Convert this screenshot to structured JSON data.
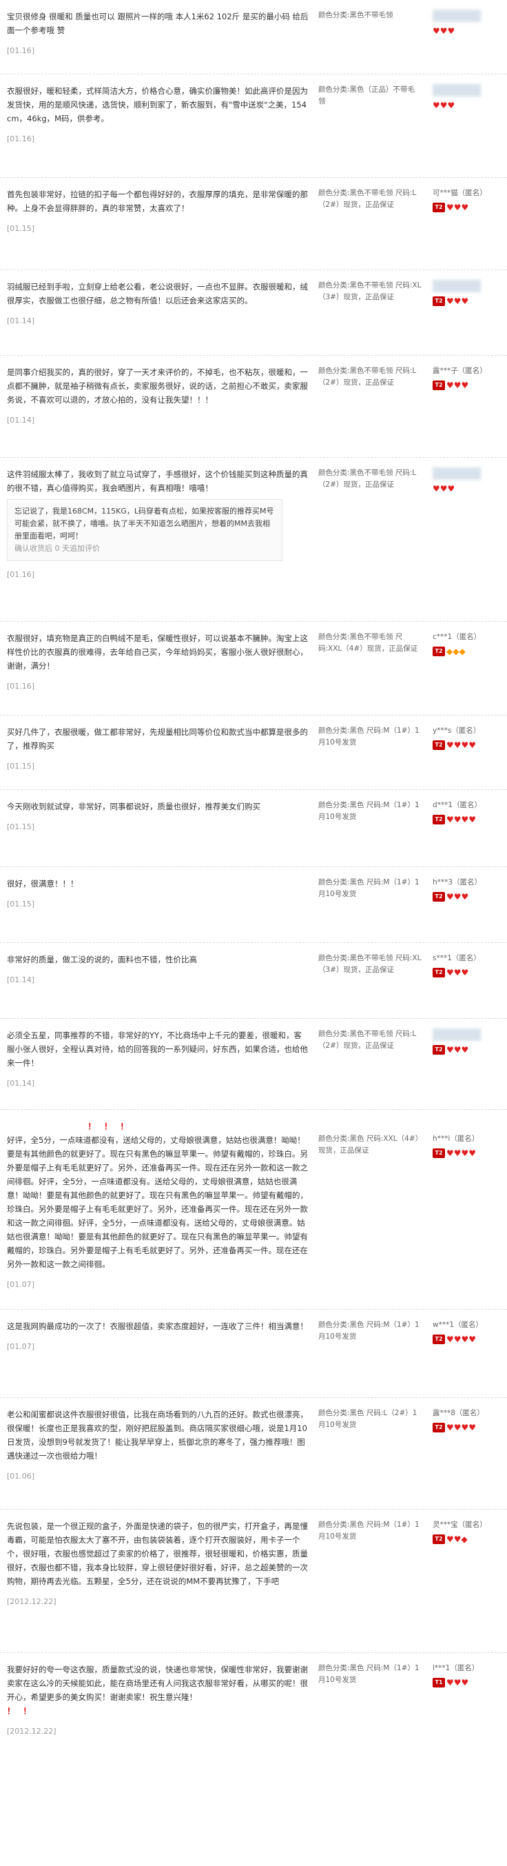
{
  "reviews": [
    {
      "content": "宝贝很修身 很暖和 质量也可以 跟照片一样的哦 本人1米62 102斤 是买的最小码 给后面一个参考哦 赞",
      "date": "[01.16]",
      "sku": "颜色分类:黑色不带毛领",
      "user": "",
      "badge": "♥♥♥"
    },
    {
      "content": "衣服很好，暖和轻柔，式样简洁大方，价格合心意，确实价廉物美！如此高评价是因为发货快，用的是顺风快递，选货快，顺利到家了，新衣服到，有\"雪中送炭\"之美，154cm，46kg，M码，供参考。",
      "date": "[01.16]",
      "sku": "颜色分类:黑色（正品）不带毛领",
      "user": "",
      "badge": "♥♥♥"
    },
    {
      "content": "首先包装非常好，拉链的扣子每一个都包得好好的，衣服厚厚的填充，是非常保暖的那种。上身不会显得胖胖的，真的非常赞，太喜欢了！",
      "date": "[01.15]",
      "sku": "颜色分类:黑色不带毛领 尺码:L（2#）现货，正品保证",
      "user": "可***猫（匿名）",
      "badge": "♥♥♥"
    },
    {
      "content": "羽绒服已经到手啦，立刻穿上给老公看，老公说很好，一点也不显胖。衣服很暖和，绒很厚实，衣服做工也很仔细，总之物有所值！以后还会来这家店买的。",
      "date": "[01.14]",
      "sku": "颜色分类:黑色不带毛领 尺码:XL（3#）现货，正品保证",
      "user": "",
      "badge": "♥♥♥"
    },
    {
      "content": "是同事介绍我买的，真的很好，穿了一天才来评价的，不掉毛，也不粘灰，很暖和，一点都不臃肿，就是袖子稍微有点长，卖家服务很好，说的话，之前担心不敢买，卖家服务说，不喜欢可以退的，才放心拍的，没有让我失望！！！",
      "date": "[01.14]",
      "sku": "颜色分类:黑色不带毛领 尺码:L（2#）现货，正品保证",
      "user": "露***子（匿名）",
      "badge": "♥♥♥"
    },
    {
      "content": "这件羽绒服太棒了，我收到了就立马试穿了，手感很好，这个价钱能买到这种质量的真的很不错，真心值得购买，我会晒图片，有真相哦！嘻嘻！",
      "date": "[01.16]",
      "sku": "颜色分类:黑色不带毛领 尺码:L（2#）现货，正品保证",
      "user": "",
      "badge": "♥♥♥",
      "append": "忘记说了，我是168CM，115KG，L码穿着有点松，如果按客服的推荐买M号可能会紧，就不换了，嘻嘻。执了半天不知道怎么晒图片，想着的MM去我相册里面看吧，呵呵！",
      "append_date": "确认收货后 0 天追加评价"
    },
    {
      "content": "衣服很好，填充物是真正的白鸭绒不是毛，保暖性很好，可以说基本不臃肿。淘宝上这样性价比的衣服真的很难得，去年给自己买，今年给妈妈买，客服小张人很好很耐心，谢谢，满分！",
      "date": "[01.16]",
      "sku": "颜色分类:黑色不带毛领 尺码:XXL（4#）现货，正品保证",
      "user": "c***1（匿名）",
      "badge": "◆◆◆"
    },
    {
      "content": "买好几件了，衣服很暖，做工都非常好，先规量相比同等价位和款式当中都算是很多的了，推荐购买",
      "date": "[01.15]",
      "sku": "颜色分类:黑色 尺码:M（1#）1月10号发货",
      "user": "y***s（匿名）",
      "badge": "♥♥♥♥"
    },
    {
      "content": "今天刚收到就试穿，非常好，同事都说好，质量也很好，推荐美女们购买",
      "date": "[01.15]",
      "sku": "颜色分类:黑色 尺码:M（1#）1月10号发货",
      "user": "d***1（匿名）",
      "badge": "♥♥♥♥"
    },
    {
      "content": "很好，很满意！！！",
      "date": "[01.15]",
      "sku": "颜色分类:黑色 尺码:M（1#）1月10号发货",
      "user": "h***3（匿名）",
      "badge": "♥♥♥"
    },
    {
      "content": "非常好的质量，做工没的说的，面料也不错，性价比高",
      "date": "[01.14]",
      "sku": "颜色分类:黑色不带毛领 尺码:XL（3#）现货，正品保证",
      "user": "s***1（匿名）",
      "badge": "♥♥♥"
    },
    {
      "content": "必须全五星，同事推荐的不错，非常好的YY，不比商场中上千元的要差，很暖和，客服小张人很好，全程认真对待，给的回答我的一系列疑问，好东西，如果合适，也给他来一件！",
      "date": "[01.14]",
      "sku": "颜色分类:黑色不带毛领 尺码:L（2#）现货，正品保证",
      "user": "",
      "badge": "♥♥♥"
    },
    {
      "content": "好评，全5分，一点味道都没有，送给父母的，丈母娘很满意，姑姑也很满意！呦呦！要是有其他颜色的就更好了。现在只有黑色的嘛显苹果一。帅望有戴帽的，珍珠白。另外要是帽子上有毛毛就更好了。另外，还准备再买一件。现在还在另外一款和这一款之间徘徊。好评，全5分，一点味道都没有。送给父母的，丈母娘很满意，姑姑也很满意！呦呦！要是有其他颜色的就更好了。现在只有黑色的嘛显苹果一。帅望有戴帽的，珍珠白。另外要是帽子上有毛毛就更好了。另外，还准备再买一件。现在还在另外一款和这一款之间徘徊。好评，全5分，一点味道都没有。送给父母的，丈母娘很满意。姑姑也很满意！呦呦！要是有其他颜色的就更好了。现在只有黑色的嘛显苹果一。帅望有戴帽的，珍珠白。另外要是帽子上有毛毛就更好了。另外，还准备再买一件。现在还在另外一款和这一款之间徘徊。",
      "date": "[01.07]",
      "sku": "颜色分类:黑色 尺码:XXL（4#）现货，正品保证",
      "user": "h***i（匿名）",
      "badge": "♥♥♥♥"
    },
    {
      "content": "这是我网购最成功的一次了！衣服很超值，卖家态度超好，一连收了三件！相当满意！",
      "date": "[01.07]",
      "sku": "颜色分类:黑色 尺码:M（1#）1月10号发货",
      "user": "w***1（匿名）",
      "badge": "♥♥♥♥"
    },
    {
      "content": "老公和闺蜜都说这件衣服很好很值，比我在商场看到的八九百的还好。款式也很漂亮，很保暖！长度也正是我喜欢的型，刚好把屁股盖到。商店隔买家很细心哦，说是1月10日发货，没想到9号就发货了！能让我早早穿上，抵御北京的寒冬了，强力推荐哦！图遇快递过一次也很给力哦！",
      "date": "[01.06]",
      "sku": "颜色分类:黑色 尺码:L（2#）1月10号发货",
      "user": "露***8（匿名）",
      "badge": "♥♥♥♥"
    },
    {
      "content": "先说包装，是一个很正规的盒子，外面是快递的袋子，包的很严实，打开盒子，再是懂毒霸，可能是怕衣服太大了塞不开，由包装袋装着，逐个打开衣服装好，用卡子一个个，很好哦，衣服也感觉超过了卖家的价格了，很推荐，很轻很暖和，价格实惠，质量很好，衣服也都不错，我本身比较胖，穿上很轻便好很好看，好评，总之超美赞的一次购物，期待再去光临。五颗星，全5分，还在说说的MM不要再犹豫了，下手吧",
      "date": "[2012.12.22]",
      "sku": "颜色分类:黑色 尺码:M（1#）1月10号发货",
      "user": "灵***宝（匿名）",
      "badge": "♥♥◆"
    },
    {
      "content": "我要好好的夸一夸这衣服，质量款式没的说，快递也非常快，保暖性非常好，我要谢谢卖家在这么冷的天候能如此，能在商场里还有人问我这衣服非常好看，从哪买的呢！很开心，希望更多的美女购买！谢谢卖家！祝生意兴隆！",
      "date": "[2012.12.22]",
      "sku": "颜色分类:黑色 尺码:M（1#）1月10号发货",
      "user": "l***1（匿名）",
      "badge": "♥♥♥"
    }
  ]
}
